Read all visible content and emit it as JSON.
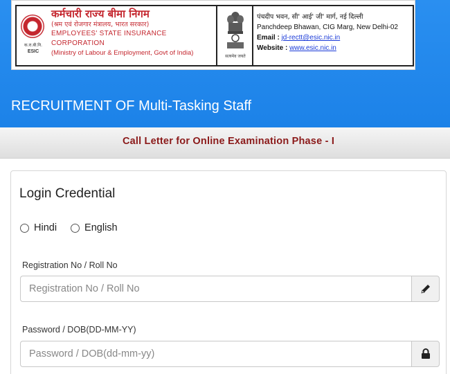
{
  "banner": {
    "org_hindi": "कर्मचारी राज्य बीमा निगम",
    "org_hindi_sub": "(श्रम एवं रोजगार मंत्रालय, भारत सरकार)",
    "org_en": "EMPLOYEES' STATE INSURANCE CORPORATION",
    "org_en_sub": "(Ministry of Labour & Employment, Govt of India)",
    "logo_text_hindi": "क.रा.बी.नि.",
    "logo_text_en": "ESIC",
    "emblem_caption": "सत्यमेव जयते",
    "address_hindi": "पंचदीप भवन, सी' आई' जी' मार्ग, नई दिल्ली",
    "address_en": "Panchdeep Bhawan, CIG Marg, New Delhi-02",
    "email_label": "Email :",
    "email_value": "jd-rectt@esic.nic.in",
    "website_label": "Website :",
    "website_value": "www.esic.nic.in"
  },
  "page_title": "RECRUITMENT OF Multi-Tasking Staff",
  "sub_title": "Call Letter for Online Examination Phase - I",
  "login": {
    "title": "Login Credential",
    "languages": [
      "Hindi",
      "English"
    ],
    "registration": {
      "label": "Registration No / Roll No",
      "placeholder": "Registration No / Roll No",
      "value": "",
      "icon": "pencil-icon"
    },
    "password": {
      "label": "Password / DOB(DD-MM-YY)",
      "placeholder": "Password / DOB(dd-mm-yy)",
      "value": "",
      "icon": "lock-icon"
    }
  },
  "colors": {
    "header_blue": "#1c82e8",
    "org_red": "#c4262e",
    "subtitle_maroon": "#8b1a1a",
    "link_blue": "#1a3ad8"
  }
}
